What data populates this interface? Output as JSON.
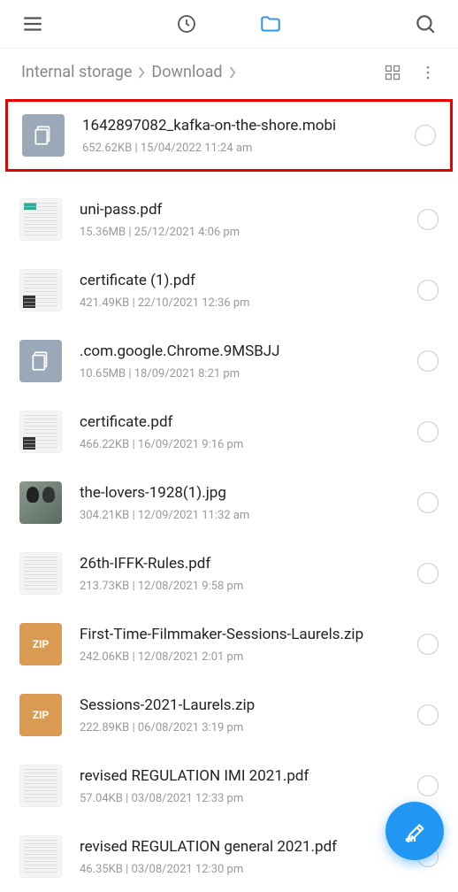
{
  "breadcrumb": {
    "root": "Internal storage",
    "current": "Download"
  },
  "files": [
    {
      "name": "1642897082_kafka-on-the-shore.mobi",
      "size": "652.62KB",
      "date": "15/04/2022 11:24 am",
      "thumb": "doc",
      "highlighted": true
    },
    {
      "name": "uni-pass.pdf",
      "size": "15.36MB",
      "date": "25/12/2021 4:06 pm",
      "thumb": "preview-color-qr"
    },
    {
      "name": "certificate (1).pdf",
      "size": "421.49KB",
      "date": "22/10/2021 12:36 pm",
      "thumb": "preview-qr"
    },
    {
      "name": ".com.google.Chrome.9MSBJJ",
      "size": "10.65MB",
      "date": "18/09/2021 8:21 pm",
      "thumb": "doc"
    },
    {
      "name": "certificate.pdf",
      "size": "466.22KB",
      "date": "16/09/2021 9:16 pm",
      "thumb": "preview-qr"
    },
    {
      "name": "the-lovers-1928(1).jpg",
      "size": "304.21KB",
      "date": "12/09/2021 11:32 am",
      "thumb": "painting"
    },
    {
      "name": "26th-IFFK-Rules.pdf",
      "size": "213.73KB",
      "date": "12/08/2021 9:58 pm",
      "thumb": "preview"
    },
    {
      "name": "First-Time-Filmmaker-Sessions-Laurels.zip",
      "size": "242.06KB",
      "date": "12/08/2021 2:01 pm",
      "thumb": "zip",
      "zipLabel": "ZIP"
    },
    {
      "name": "Sessions-2021-Laurels.zip",
      "size": "222.89KB",
      "date": "06/08/2021 3:19 pm",
      "thumb": "zip",
      "zipLabel": "ZIP"
    },
    {
      "name": "revised REGULATION IMI 2021.pdf",
      "size": "57.04KB",
      "date": "03/08/2021 12:33 pm",
      "thumb": "preview"
    },
    {
      "name": "revised REGULATION general 2021.pdf",
      "size": "46.35KB",
      "date": "03/08/2021 12:30 pm",
      "thumb": "preview"
    }
  ],
  "metaSeparator": "  |  "
}
